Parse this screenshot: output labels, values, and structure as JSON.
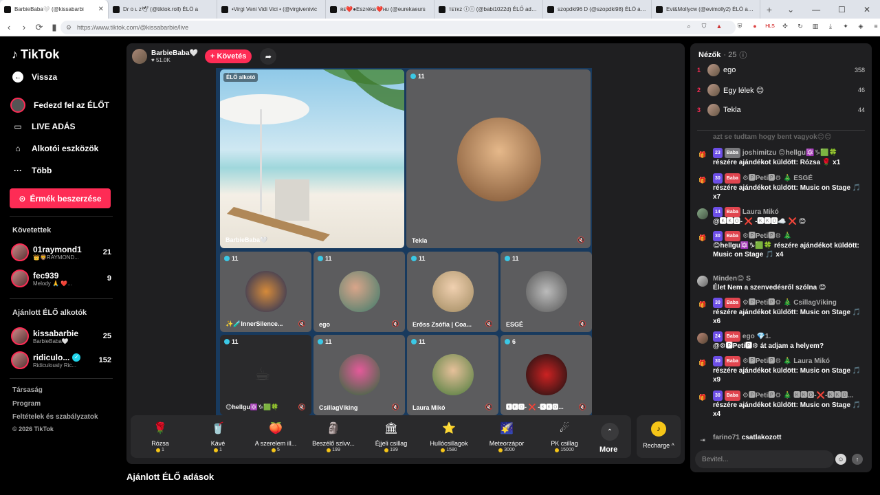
{
  "browser": {
    "tabs": [
      {
        "label": "BarbieBaba🤍 (@kissabarbi",
        "active": true
      },
      {
        "label": "Dɾ o ʟ z🕊 (@tiktok.roll) ÉLŐ a",
        "active": false
      },
      {
        "label": "•Virgi Veni Vidi Vici • (@virgivenivic",
        "active": false
      },
      {
        "label": "ʀᴇ❤️●Eszréka❤️ʜᴜ (@eurekaeurs",
        "active": false
      },
      {
        "label": "ᴛᴇᴛᴋᴢ ⓘⓘ (@babi1022d) ÉLŐ adásb",
        "active": false
      },
      {
        "label": "szopdki96 D (@szopdki98) ÉLŐ adás",
        "active": false
      },
      {
        "label": "Evi&Mollycw (@evimolly2) ÉLŐ adás",
        "active": false
      }
    ],
    "url": "https://www.tiktok.com/@kissabarbie/live"
  },
  "sidebar": {
    "logo": "TikTok",
    "back": "Vissza",
    "nav": [
      "Fedezd fel az ÉLŐT",
      "LIVE ADÁS",
      "Alkotói eszközök",
      "Több"
    ],
    "coins_button": "Érmék beszerzése",
    "following_title": "Követettek",
    "following": [
      {
        "name": "01raymond1",
        "sub": "👑🦁RAYMOND...",
        "count": "21"
      },
      {
        "name": "fec939",
        "sub": "Melody 🙏 ❤️...",
        "count": "9"
      }
    ],
    "recommended_title": "Ajánlott ÉLŐ alkotók",
    "recommended": [
      {
        "name": "kissabarbie",
        "sub": "BarbieBaba🤍",
        "count": "25"
      },
      {
        "name": "ridiculo...",
        "sub": "Ridiculously Ric...",
        "count": "152"
      }
    ],
    "footer": [
      "Társaság",
      "Program",
      "Feltételek és szabályzatok",
      "© 2026 TikTok"
    ]
  },
  "stage": {
    "host_name": "BarbieBaba🤍",
    "host_likes": "51.0K",
    "follow_label": "+ Követés",
    "live_tag": "ÉLŐ alkotó",
    "host_tile_name": "BarbieBaba🤍",
    "tiles": [
      {
        "name": "Tekla",
        "badge": "11"
      },
      {
        "name": "✨🧪InnerSilence...",
        "badge": "11"
      },
      {
        "name": "ego",
        "badge": "11"
      },
      {
        "name": "Erőss Zsófia | Coa...",
        "badge": "11"
      },
      {
        "name": "ESGÉ",
        "badge": "11"
      },
      {
        "name": "😊hellgu🔯♑🟩🍀",
        "badge": "11"
      },
      {
        "name": "CsillagViking",
        "badge": "11"
      },
      {
        "name": "Laura Mikó",
        "badge": "11"
      },
      {
        "name": "🅺🅺🅾- ❌ -🅺🅺🅾...",
        "badge": "6"
      }
    ],
    "gifts": [
      {
        "name": "Rózsa",
        "price": "1",
        "icon": "🌹"
      },
      {
        "name": "Kávé",
        "price": "1",
        "icon": "🥤"
      },
      {
        "name": "A szerelem ill...",
        "price": "5",
        "icon": "🍑"
      },
      {
        "name": "Beszélő szívv...",
        "price": "199",
        "icon": "🗿"
      },
      {
        "name": "Éjjeli csillag",
        "price": "199",
        "icon": "🏛"
      },
      {
        "name": "Hullócsillagok",
        "price": "1580",
        "icon": "⭐"
      },
      {
        "name": "Meteorzápor",
        "price": "3000",
        "icon": "🌠"
      },
      {
        "name": "PK csillag",
        "price": "15000",
        "icon": "☄"
      }
    ],
    "more_label": "More",
    "recharge_label": "Recharge ^",
    "suggest_title": "Ajánlott ÉLŐ adások"
  },
  "chat": {
    "viewers_title": "Nézők",
    "viewers_count": "· 25",
    "top_viewers": [
      {
        "rank": "1",
        "name": "ego",
        "score": "358"
      },
      {
        "rank": "2",
        "name": "Egy lélek 😊",
        "score": "46"
      },
      {
        "rank": "3",
        "name": "Tekla",
        "score": "44"
      }
    ],
    "faded_line": "azt se tudtam hogy bent vagyok😊😊",
    "messages": [
      {
        "lvl": "23",
        "fan": "Baba",
        "user": "joshimitzu 😊hellgu🔯♑🟩🍀",
        "text": "részére ajándékot küldött: Rózsa 🌹 x1",
        "icon": "gift"
      },
      {
        "lvl": "30",
        "fan": "Baba",
        "user": "⚙🅿Peti🅿⚙ 🎄 ESGÉ",
        "text": "részére ajándékot küldött: Music on Stage 🎵 x7",
        "icon": "gift"
      },
      {
        "lvl": "14",
        "fan": "Baba",
        "user": "Laura Mikó",
        "text": "@🅺🅺🅾- ❌ -🅺🅺🅾☁️ ❌ 😊",
        "icon": "avatar"
      },
      {
        "lvl": "30",
        "fan": "Baba",
        "user": "⚙🅿Peti🅿⚙ 🎄",
        "text": "😊hellgu🔯♑🟩🍀 részére ajándékot küldött: Music on Stage 🎵 x4",
        "icon": "gift"
      },
      {
        "lvl": "",
        "fan": "",
        "user": "Minden😊 S",
        "text": "Élet Nem a szenvedésről szólna 😊",
        "icon": "avatar"
      },
      {
        "lvl": "30",
        "fan": "Baba",
        "user": "⚙🅿Peti🅿⚙ 🎄 CsillagViking",
        "text": "részére ajándékot küldött: Music on Stage 🎵 x6",
        "icon": "gift"
      },
      {
        "lvl": "24",
        "fan": "Baba",
        "user": "ego 💎1.",
        "text": "@⚙🅿Peti🅿⚙ át adjam a helyem?",
        "icon": "avatar"
      },
      {
        "lvl": "30",
        "fan": "Baba",
        "user": "⚙🅿Peti🅿⚙ 🎄 Laura Mikó",
        "text": "részére ajándékot küldött: Music on Stage 🎵 x9",
        "icon": "gift"
      },
      {
        "lvl": "30",
        "fan": "Baba",
        "user": "⚙🅿Peti🅿⚙ 🎄 🅺🅺🅾-❌-🅺🅺🅾...",
        "text": "részére ajándékot küldött: Music on Stage 🎵 x4",
        "icon": "gift"
      }
    ],
    "joined_user": "farino71",
    "joined_text": "csatlakozott",
    "input_placeholder": "Bevitel..."
  },
  "colors": {
    "accent": "#fe2c55",
    "badge": "#3bc8e6",
    "coin": "#f5c518"
  }
}
